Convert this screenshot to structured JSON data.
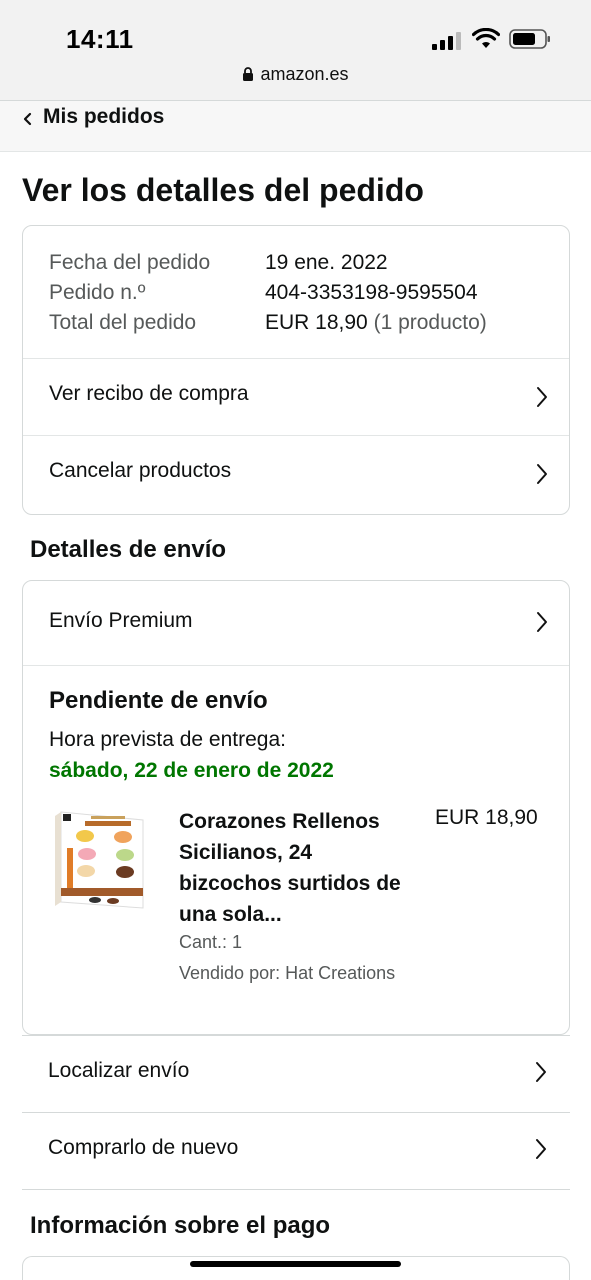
{
  "status_bar": {
    "time": "14:11"
  },
  "browser": {
    "url": "amazon.es"
  },
  "breadcrumb": {
    "label": "Mis pedidos"
  },
  "page": {
    "title": "Ver los detalles del pedido"
  },
  "order_summary": {
    "rows": [
      {
        "label": "Fecha del pedido",
        "value": "19 ene. 2022"
      },
      {
        "label": "Pedido n.º",
        "value": "404-3353198-9595504"
      },
      {
        "label": "Total del pedido",
        "value": "EUR 18,90",
        "extra": "(1 producto)"
      }
    ],
    "links": [
      {
        "label": "Ver recibo de compra"
      },
      {
        "label": "Cancelar productos"
      }
    ]
  },
  "shipping": {
    "heading": "Detalles de envío",
    "method": "Envío Premium",
    "status": "Pendiente de envío",
    "eta_label": "Hora prevista de entrega:",
    "eta_date": "sábado, 22 de enero de 2022",
    "eta_color": "#007600",
    "product": {
      "name": "Corazones Rellenos Sicilianos, 24 bizcochos surtidos de una sola...",
      "price": "EUR 18,90",
      "qty": "Cant.: 1",
      "seller": "Vendido por: Hat Creations"
    }
  },
  "actions": [
    {
      "label": "Localizar envío"
    },
    {
      "label": "Comprarlo de nuevo"
    }
  ],
  "payment": {
    "heading": "Información sobre el pago"
  }
}
